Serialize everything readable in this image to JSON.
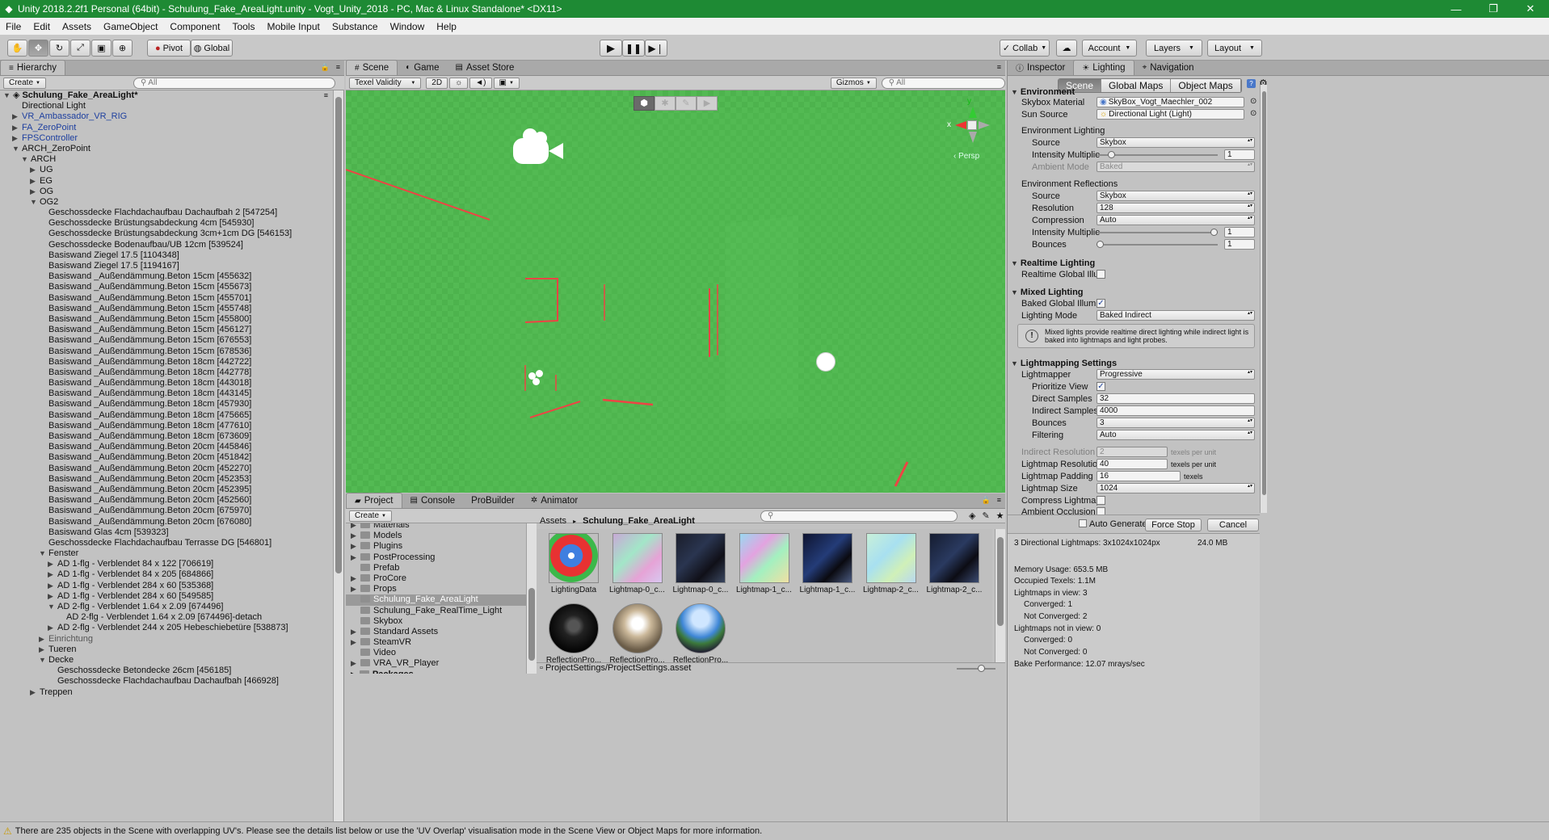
{
  "window": {
    "title": "Unity 2018.2.2f1 Personal (64bit) - Schulung_Fake_AreaLight.unity - Vogt_Unity_2018 - PC, Mac & Linux Standalone* <DX11>",
    "logo": "unity-icon",
    "accent": "#1e8a34"
  },
  "menu": [
    "File",
    "Edit",
    "Assets",
    "GameObject",
    "Component",
    "Tools",
    "Mobile Input",
    "Substance",
    "Window",
    "Help"
  ],
  "toolbar": {
    "pivot": "Pivot",
    "global": "Global",
    "collab": "Collab",
    "account": "Account",
    "layers": "Layers",
    "layout": "Layout"
  },
  "hierarchy": {
    "tab": "Hierarchy",
    "create": "Create",
    "search_placeholder": "All",
    "rows": [
      {
        "t": "Schulung_Fake_AreaLight*",
        "d": 0,
        "a": "down",
        "s": "bold"
      },
      {
        "t": "Directional Light",
        "d": 1,
        "a": "",
        "s": ""
      },
      {
        "t": "VR_Ambassador_VR_RIG",
        "d": 1,
        "a": "right",
        "s": "blue"
      },
      {
        "t": "FA_ZeroPoint",
        "d": 1,
        "a": "right",
        "s": "blue"
      },
      {
        "t": "FPSController",
        "d": 1,
        "a": "right",
        "s": "blue"
      },
      {
        "t": "ARCH_ZeroPoint",
        "d": 1,
        "a": "down",
        "s": ""
      },
      {
        "t": "ARCH",
        "d": 2,
        "a": "down",
        "s": ""
      },
      {
        "t": "UG",
        "d": 3,
        "a": "right",
        "s": ""
      },
      {
        "t": "EG",
        "d": 3,
        "a": "right",
        "s": ""
      },
      {
        "t": "OG",
        "d": 3,
        "a": "right",
        "s": ""
      },
      {
        "t": "OG2",
        "d": 3,
        "a": "down",
        "s": ""
      },
      {
        "t": "Geschossdecke Flachdachaufbau Dachaufbah 2 [547254]",
        "d": 4,
        "a": "",
        "s": ""
      },
      {
        "t": "Geschossdecke Brüstungsabdeckung 4cm [545930]",
        "d": 4,
        "a": "",
        "s": ""
      },
      {
        "t": "Geschossdecke Brüstungsabdeckung 3cm+1cm DG [546153]",
        "d": 4,
        "a": "",
        "s": ""
      },
      {
        "t": "Geschossdecke Bodenaufbau/UB 12cm [539524]",
        "d": 4,
        "a": "",
        "s": ""
      },
      {
        "t": "Basiswand Ziegel 17.5 [1104348]",
        "d": 4,
        "a": "",
        "s": ""
      },
      {
        "t": "Basiswand Ziegel 17.5 [1194167]",
        "d": 4,
        "a": "",
        "s": ""
      },
      {
        "t": "Basiswand _Außendämmung.Beton 15cm [455632]",
        "d": 4,
        "a": "",
        "s": ""
      },
      {
        "t": "Basiswand _Außendämmung.Beton 15cm [455673]",
        "d": 4,
        "a": "",
        "s": ""
      },
      {
        "t": "Basiswand _Außendämmung.Beton 15cm [455701]",
        "d": 4,
        "a": "",
        "s": ""
      },
      {
        "t": "Basiswand _Außendämmung.Beton 15cm [455748]",
        "d": 4,
        "a": "",
        "s": ""
      },
      {
        "t": "Basiswand _Außendämmung.Beton 15cm [455800]",
        "d": 4,
        "a": "",
        "s": ""
      },
      {
        "t": "Basiswand _Außendämmung.Beton 15cm [456127]",
        "d": 4,
        "a": "",
        "s": ""
      },
      {
        "t": "Basiswand _Außendämmung.Beton 15cm [676553]",
        "d": 4,
        "a": "",
        "s": ""
      },
      {
        "t": "Basiswand _Außendämmung.Beton 15cm [678536]",
        "d": 4,
        "a": "",
        "s": ""
      },
      {
        "t": "Basiswand _Außendämmung.Beton 18cm [442722]",
        "d": 4,
        "a": "",
        "s": ""
      },
      {
        "t": "Basiswand _Außendämmung.Beton 18cm [442778]",
        "d": 4,
        "a": "",
        "s": ""
      },
      {
        "t": "Basiswand _Außendämmung.Beton 18cm [443018]",
        "d": 4,
        "a": "",
        "s": ""
      },
      {
        "t": "Basiswand _Außendämmung.Beton 18cm [443145]",
        "d": 4,
        "a": "",
        "s": ""
      },
      {
        "t": "Basiswand _Außendämmung.Beton 18cm [457930]",
        "d": 4,
        "a": "",
        "s": ""
      },
      {
        "t": "Basiswand _Außendämmung.Beton 18cm [475665]",
        "d": 4,
        "a": "",
        "s": ""
      },
      {
        "t": "Basiswand _Außendämmung.Beton 18cm [477610]",
        "d": 4,
        "a": "",
        "s": ""
      },
      {
        "t": "Basiswand _Außendämmung.Beton 18cm [673609]",
        "d": 4,
        "a": "",
        "s": ""
      },
      {
        "t": "Basiswand _Außendämmung.Beton 20cm [445846]",
        "d": 4,
        "a": "",
        "s": ""
      },
      {
        "t": "Basiswand _Außendämmung.Beton 20cm [451842]",
        "d": 4,
        "a": "",
        "s": ""
      },
      {
        "t": "Basiswand _Außendämmung.Beton 20cm [452270]",
        "d": 4,
        "a": "",
        "s": ""
      },
      {
        "t": "Basiswand _Außendämmung.Beton 20cm [452353]",
        "d": 4,
        "a": "",
        "s": ""
      },
      {
        "t": "Basiswand _Außendämmung.Beton 20cm [452395]",
        "d": 4,
        "a": "",
        "s": ""
      },
      {
        "t": "Basiswand _Außendämmung.Beton 20cm [452560]",
        "d": 4,
        "a": "",
        "s": ""
      },
      {
        "t": "Basiswand _Außendämmung.Beton 20cm [675970]",
        "d": 4,
        "a": "",
        "s": ""
      },
      {
        "t": "Basiswand _Außendämmung.Beton 20cm [676080]",
        "d": 4,
        "a": "",
        "s": ""
      },
      {
        "t": "Basiswand Glas 4cm [539323]",
        "d": 4,
        "a": "",
        "s": ""
      },
      {
        "t": "Geschossdecke Flachdachaufbau Terrasse DG [546801]",
        "d": 4,
        "a": "",
        "s": ""
      },
      {
        "t": "Fenster",
        "d": 4,
        "a": "down",
        "s": ""
      },
      {
        "t": "AD 1-flg - Verblendet 84 x 122 [706619]",
        "d": 5,
        "a": "right",
        "s": ""
      },
      {
        "t": "AD 1-flg - Verblendet 84 x 205 [684866]",
        "d": 5,
        "a": "right",
        "s": ""
      },
      {
        "t": "AD 1-flg - Verblendet 284 x 60 [535368]",
        "d": 5,
        "a": "right",
        "s": ""
      },
      {
        "t": "AD 1-flg - Verblendet 284 x 60 [549585]",
        "d": 5,
        "a": "right",
        "s": ""
      },
      {
        "t": "AD 2-flg - Verblendet 1.64 x 2.09 [674496]",
        "d": 5,
        "a": "down",
        "s": ""
      },
      {
        "t": "AD 2-flg - Verblendet 1.64 x 2.09 [674496]-detach",
        "d": 6,
        "a": "",
        "s": ""
      },
      {
        "t": "AD 2-flg - Verblendet 244 x 205 Hebeschiebetüre [538873]",
        "d": 5,
        "a": "right",
        "s": ""
      },
      {
        "t": "Einrichtung",
        "d": 4,
        "a": "right",
        "s": "grey"
      },
      {
        "t": "Tueren",
        "d": 4,
        "a": "right",
        "s": ""
      },
      {
        "t": "Decke",
        "d": 4,
        "a": "down",
        "s": ""
      },
      {
        "t": "Geschossdecke Betondecke 26cm [456185]",
        "d": 5,
        "a": "",
        "s": ""
      },
      {
        "t": "Geschossdecke Flachdachaufbau Dachaufbah [466928]",
        "d": 5,
        "a": "",
        "s": ""
      },
      {
        "t": "Treppen",
        "d": 3,
        "a": "right",
        "s": ""
      }
    ]
  },
  "scene": {
    "tabs": [
      "Scene",
      "Game",
      "Asset Store"
    ],
    "shading": "Texel Validity",
    "mode2d": "2D",
    "gizmos": "Gizmos",
    "search_placeholder": "All",
    "persp": "Persp",
    "axis_y": "y",
    "axis_x": "x",
    "ground_color": "#4db34d"
  },
  "project": {
    "tabs": [
      "Project",
      "Console",
      "ProBuilder",
      "Animator"
    ],
    "create": "Create",
    "folders": [
      {
        "t": "Materials",
        "a": "right",
        "sel": false
      },
      {
        "t": "Models",
        "a": "right",
        "sel": false
      },
      {
        "t": "Plugins",
        "a": "right",
        "sel": false
      },
      {
        "t": "PostProcessing",
        "a": "right",
        "sel": false
      },
      {
        "t": "Prefab",
        "a": "",
        "sel": false
      },
      {
        "t": "ProCore",
        "a": "right",
        "sel": false
      },
      {
        "t": "Props",
        "a": "right",
        "sel": false
      },
      {
        "t": "Schulung_Fake_AreaLight",
        "a": "",
        "sel": true
      },
      {
        "t": "Schulung_Fake_RealTime_Light",
        "a": "",
        "sel": false
      },
      {
        "t": "Skybox",
        "a": "",
        "sel": false
      },
      {
        "t": "Standard Assets",
        "a": "right",
        "sel": false
      },
      {
        "t": "SteamVR",
        "a": "right",
        "sel": false
      },
      {
        "t": "Video",
        "a": "",
        "sel": false
      },
      {
        "t": "VRA_VR_Player",
        "a": "right",
        "sel": false
      }
    ],
    "packages": "Packages",
    "breadcrumb_root": "Assets",
    "breadcrumb_sep": "▸",
    "breadcrumb_current": "Schulung_Fake_AreaLight",
    "assets": [
      {
        "t": "LightingData",
        "k": "data"
      },
      {
        "t": "Lightmap-0_c...",
        "k": "lm0a"
      },
      {
        "t": "Lightmap-0_c...",
        "k": "lm0b"
      },
      {
        "t": "Lightmap-1_c...",
        "k": "lm1a"
      },
      {
        "t": "Lightmap-1_c...",
        "k": "lm1b"
      },
      {
        "t": "Lightmap-2_c...",
        "k": "lm2a"
      },
      {
        "t": "Lightmap-2_c...",
        "k": "lm2b"
      },
      {
        "t": "ReflectionPro...",
        "k": "ref0"
      },
      {
        "t": "ReflectionPro...",
        "k": "ref1"
      },
      {
        "t": "ReflectionPro...",
        "k": "ref2"
      }
    ],
    "footer_path": "ProjectSettings/ProjectSettings.asset"
  },
  "inspector": {
    "tabs": [
      "Inspector",
      "Lighting",
      "Navigation"
    ],
    "segments": [
      "Scene",
      "Global Maps",
      "Object Maps"
    ],
    "environment": {
      "header": "Environment",
      "skybox_label": "Skybox Material",
      "skybox_value": "SkyBox_Vogt_Maechler_002",
      "sun_label": "Sun Source",
      "sun_value": "Directional Light (Light)",
      "env_lighting": "Environment Lighting",
      "source_label": "Source",
      "source_value": "Skybox",
      "intensity_label": "Intensity Multiplie",
      "intensity_value": "1",
      "intensity_fraction": 0.1,
      "ambient_label": "Ambient Mode",
      "ambient_value": "Baked",
      "env_reflections": "Environment Reflections",
      "r_source_label": "Source",
      "r_source_value": "Skybox",
      "resolution_label": "Resolution",
      "resolution_value": "128",
      "compression_label": "Compression",
      "compression_value": "Auto",
      "r_intensity_label": "Intensity Multiplie",
      "r_intensity_value": "1",
      "r_intensity_fraction": 1.0,
      "bounces_label": "Bounces",
      "bounces_value": "1",
      "bounces_fraction": 0.0
    },
    "realtime": {
      "header": "Realtime Lighting",
      "rgi_label": "Realtime Global Illu",
      "rgi_checked": false
    },
    "mixed": {
      "header": "Mixed Lighting",
      "bgi_label": "Baked Global Illumi",
      "bgi_checked": true,
      "mode_label": "Lighting Mode",
      "mode_value": "Baked Indirect",
      "note": "Mixed lights provide realtime direct lighting while indirect light is baked into lightmaps and light probes."
    },
    "lightmapping": {
      "header": "Lightmapping Settings",
      "lightmapper_label": "Lightmapper",
      "lightmapper_value": "Progressive",
      "prioritize_label": "Prioritize View",
      "prioritize_checked": true,
      "direct_label": "Direct Samples",
      "direct_value": "32",
      "indirect_label": "Indirect Samples",
      "indirect_value": "4000",
      "bounces_label": "Bounces",
      "bounces_value": "3",
      "filtering_label": "Filtering",
      "filtering_value": "Auto",
      "ind_res_label": "Indirect Resolution",
      "ind_res_value": "2",
      "lm_res_label": "Lightmap Resolution",
      "lm_res_value": "40",
      "lm_pad_label": "Lightmap Padding",
      "lm_pad_value": "16",
      "lm_size_label": "Lightmap Size",
      "lm_size_value": "1024",
      "compress_label": "Compress Lightmap",
      "ao_label": "Ambient Occlusion",
      "texels_per_unit": "texels per unit",
      "texels": "texels"
    },
    "bake": {
      "auto_label": "Auto Generate",
      "force_stop": "Force Stop",
      "cancel": "Cancel"
    },
    "stats": {
      "lightmaps": "3 Directional Lightmaps: 3x1024x1024px",
      "size": "24.0 MB",
      "memory": "Memory Usage: 653.5 MB",
      "texels": "Occupied Texels: 1.1M",
      "in_view": "Lightmaps in view: 3",
      "conv1": "Converged: 1",
      "notconv1": "Not Converged: 2",
      "not_in_view": "Lightmaps not in view: 0",
      "conv2": "Converged: 0",
      "notconv2": "Not Converged: 0",
      "perf": "Bake Performance: 12.07 mrays/sec"
    }
  },
  "status": "There are 235 objects in the Scene with overlapping UV's. Please see the details list below or use the 'UV Overlap' visualisation mode in the Scene View or Object Maps for more information."
}
